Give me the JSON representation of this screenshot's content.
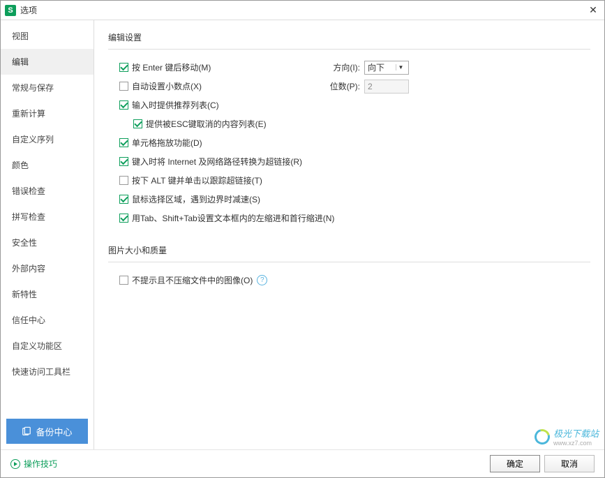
{
  "window": {
    "icon_letter": "S",
    "title": "选项"
  },
  "sidebar": {
    "items": [
      {
        "key": "view",
        "label": "视图",
        "active": false
      },
      {
        "key": "edit",
        "label": "编辑",
        "active": true
      },
      {
        "key": "general-save",
        "label": "常规与保存",
        "active": false
      },
      {
        "key": "recalc",
        "label": "重新计算",
        "active": false
      },
      {
        "key": "custom-seq",
        "label": "自定义序列",
        "active": false
      },
      {
        "key": "color",
        "label": "颜色",
        "active": false
      },
      {
        "key": "error-check",
        "label": "错误检查",
        "active": false
      },
      {
        "key": "spell-check",
        "label": "拼写检查",
        "active": false
      },
      {
        "key": "security",
        "label": "安全性",
        "active": false
      },
      {
        "key": "external",
        "label": "外部内容",
        "active": false
      },
      {
        "key": "new-feature",
        "label": "新特性",
        "active": false
      },
      {
        "key": "trust",
        "label": "信任中心",
        "active": false
      },
      {
        "key": "custom-ribbon",
        "label": "自定义功能区",
        "active": false
      },
      {
        "key": "qat",
        "label": "快速访问工具栏",
        "active": false
      }
    ],
    "backup_label": "备份中心"
  },
  "sections": {
    "edit": {
      "title": "编辑设置",
      "enter_move": {
        "checked": true,
        "label": "按 Enter 键后移动(M)"
      },
      "direction": {
        "label": "方向(I):",
        "value": "向下"
      },
      "auto_decimal": {
        "checked": false,
        "label": "自动设置小数点(X)"
      },
      "places": {
        "label": "位数(P):",
        "value": "2"
      },
      "recommend_list": {
        "checked": true,
        "label": "输入时提供推荐列表(C)"
      },
      "esc_list": {
        "checked": true,
        "label": "提供被ESC键取消的内容列表(E)"
      },
      "drag_drop": {
        "checked": true,
        "label": "单元格拖放功能(D)"
      },
      "hyperlink": {
        "checked": true,
        "label": "键入时将 Internet 及网络路径转换为超链接(R)"
      },
      "alt_track": {
        "checked": false,
        "label": "按下 ALT 键并单击以跟踪超链接(T)"
      },
      "mouse_slow": {
        "checked": true,
        "label": "鼠标选择区域，遇到边界时减速(S)"
      },
      "tab_indent": {
        "checked": true,
        "label": "用Tab、Shift+Tab设置文本框内的左缩进和首行缩进(N)"
      }
    },
    "image": {
      "title": "图片大小和质量",
      "no_compress": {
        "checked": false,
        "label": "不提示且不压缩文件中的图像(O)"
      }
    }
  },
  "footer": {
    "tips": "操作技巧",
    "ok": "确定",
    "cancel": "取消"
  },
  "watermark": {
    "brand": "极光下载站",
    "url": "www.xz7.com"
  }
}
